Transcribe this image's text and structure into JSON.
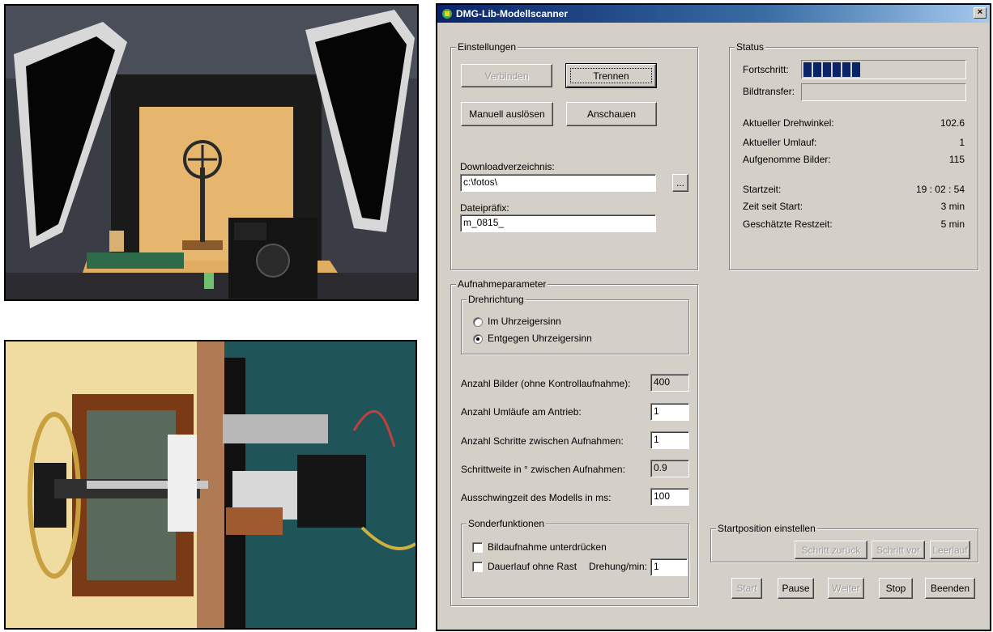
{
  "window": {
    "title": "DMG-Lib-Modellscanner",
    "close_glyph": "×"
  },
  "settings": {
    "legend": "Einstellungen",
    "connect_label": "Verbinden",
    "disconnect_label": "Trennen",
    "manual_trigger_label": "Manuell auslösen",
    "view_label": "Anschauen",
    "download_dir_label": "Downloadverzeichnis:",
    "download_dir_value": "c:\\fotos\\",
    "browse_label": "...",
    "file_prefix_label": "Dateipräfix:",
    "file_prefix_value": "m_0815_"
  },
  "status": {
    "legend": "Status",
    "progress_label": "Fortschritt:",
    "progress_segments": 6,
    "transfer_label": "Bildtransfer:",
    "rotation_angle_label": "Aktueller Drehwinkel:",
    "rotation_angle_value": "102.6",
    "revolution_label": "Aktueller Umlauf:",
    "revolution_value": "1",
    "images_taken_label": "Aufgenomme Bilder:",
    "images_taken_value": "115",
    "start_time_label": "Startzeit:",
    "start_time_value": "19 : 02 : 54",
    "elapsed_label": "Zeit seit Start:",
    "elapsed_value": "3 min",
    "remaining_label": "Geschätzte Restzeit:",
    "remaining_value": "5 min"
  },
  "params": {
    "legend": "Aufnahmeparameter",
    "direction_legend": "Drehrichtung",
    "clockwise_label": "Im Uhrzeigersinn",
    "counterclockwise_label": "Entgegen Uhrzeigersinn",
    "num_images_label": "Anzahl Bilder (ohne Kontrollaufnahme):",
    "num_images_value": "400",
    "num_revolutions_label": "Anzahl Umläufe am Antrieb:",
    "num_revolutions_value": "1",
    "num_steps_label": "Anzahl Schritte zwischen Aufnahmen:",
    "num_steps_value": "1",
    "step_width_label": "Schrittweite in ° zwischen Aufnahmen:",
    "step_width_value": "0.9",
    "settle_time_label": "Ausschwingzeit des Modells in ms:",
    "settle_time_value": "100"
  },
  "special": {
    "legend": "Sonderfunktionen",
    "suppress_capture_label": "Bildaufnahme unterdrücken",
    "continuous_label": "Dauerlauf ohne Rast",
    "rpm_label": "Drehung/min:",
    "rpm_value": "1"
  },
  "start_position": {
    "legend": "Startposition einstellen",
    "step_back_label": "Schritt zurück",
    "step_forward_label": "Schritt vor",
    "idle_label": "Leerlauf"
  },
  "controls": {
    "start_label": "Start",
    "pause_label": "Pause",
    "continue_label": "Weiter",
    "stop_label": "Stop",
    "exit_label": "Beenden"
  }
}
